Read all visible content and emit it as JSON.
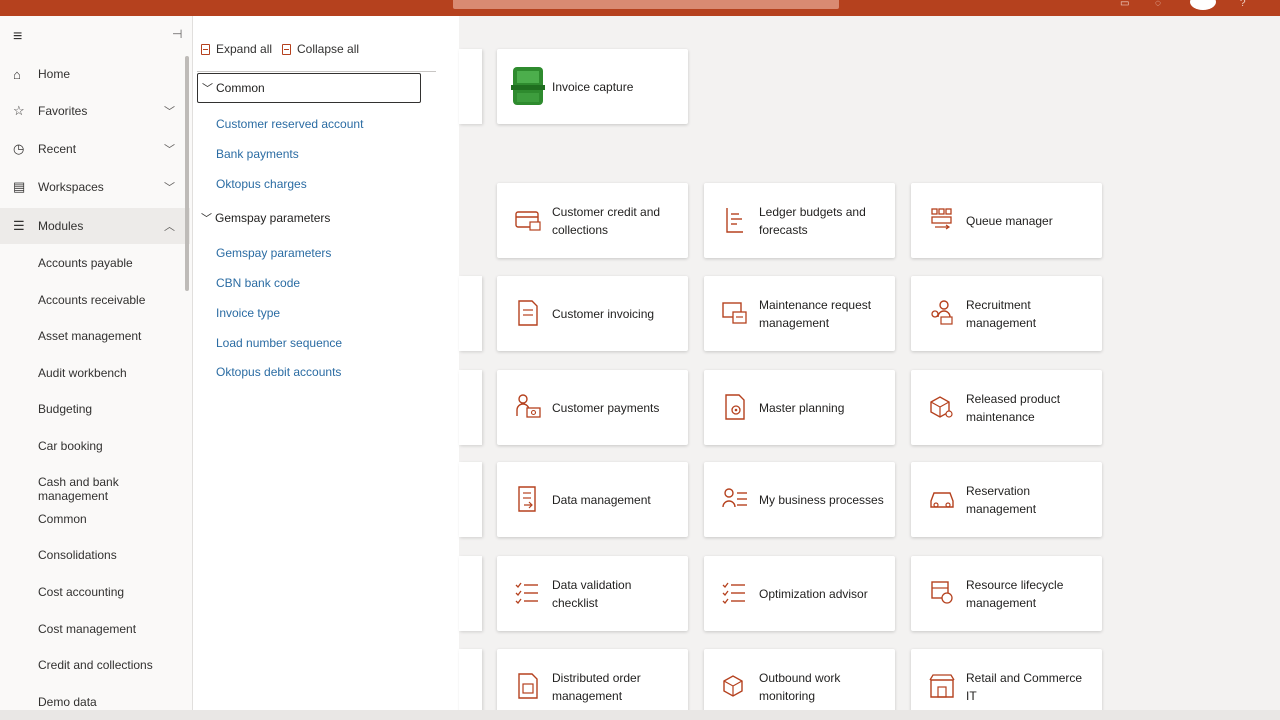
{
  "colors": {
    "accent": "#b5411e",
    "link": "#2b6ca3",
    "text": "#323130",
    "green": "#2e8b2e"
  },
  "nav": {
    "items": [
      {
        "label": "Home",
        "icon": "home-icon"
      },
      {
        "label": "Favorites",
        "icon": "star-icon"
      },
      {
        "label": "Recent",
        "icon": "clock-icon"
      },
      {
        "label": "Workspaces",
        "icon": "workspaces-icon"
      },
      {
        "label": "Modules",
        "icon": "modules-icon"
      }
    ],
    "modules": [
      "Accounts payable",
      "Accounts receivable",
      "Asset management",
      "Audit workbench",
      "Budgeting",
      "Car booking",
      "Cash and bank management",
      "Common",
      "Consolidations",
      "Cost accounting",
      "Cost management",
      "Credit and collections",
      "Demo data"
    ]
  },
  "flyout": {
    "expand_all": "Expand all",
    "collapse_all": "Collapse all",
    "groups": [
      {
        "title": "Common",
        "links": [
          "Customer reserved account",
          "Bank payments",
          "Oktopus charges"
        ]
      },
      {
        "title": "Gemspay parameters",
        "links": [
          "Gemspay parameters",
          "CBN bank code",
          "Invoice type",
          "Load number sequence",
          "Oktopus debit accounts"
        ]
      }
    ]
  },
  "tiles": {
    "top": "Invoice capture",
    "col1": [
      "Customer credit and collections",
      "Customer invoicing",
      "Customer payments",
      "Data management",
      "Data validation checklist",
      "Distributed order management"
    ],
    "col2": [
      "Ledger budgets and forecasts",
      "Maintenance request management",
      "Master planning",
      "My business processes",
      "Optimization advisor",
      "Outbound work monitoring"
    ],
    "col3": [
      "Queue manager",
      "Recruitment management",
      "Released product maintenance",
      "Reservation management",
      "Resource lifecycle management",
      "Retail and Commerce IT"
    ]
  }
}
